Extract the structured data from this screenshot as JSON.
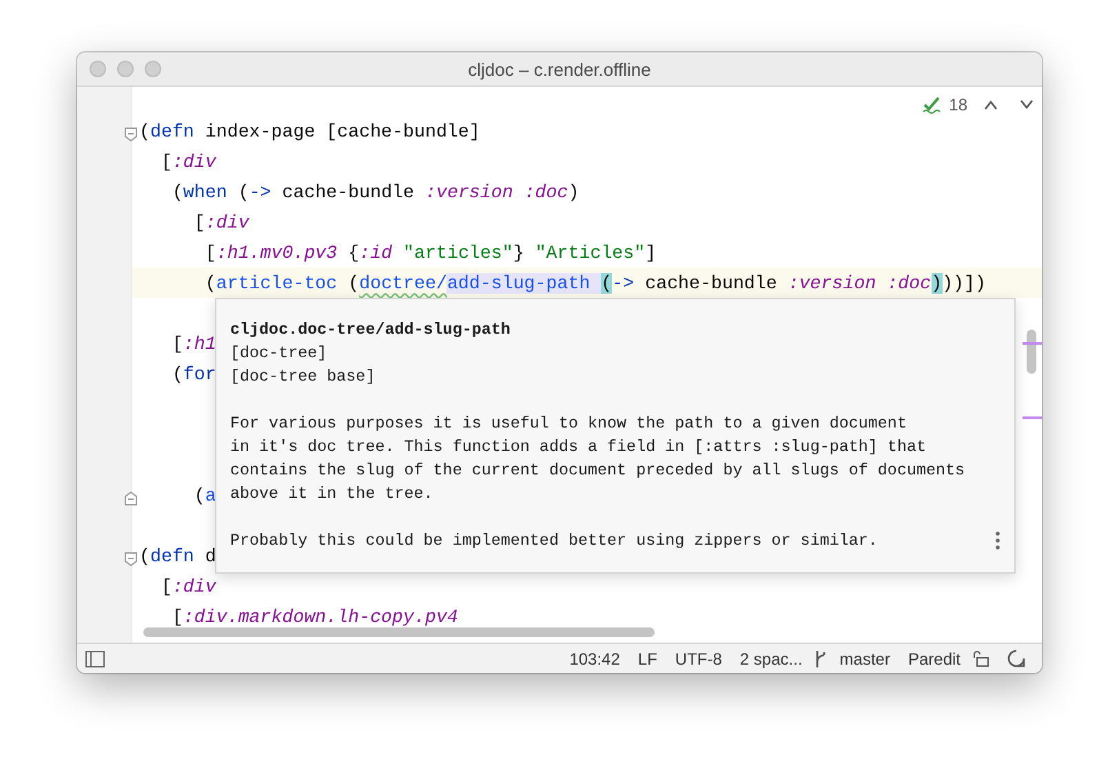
{
  "window": {
    "title": "cljdoc – c.render.offline"
  },
  "inspections": {
    "count": "18"
  },
  "code": {
    "lines": [
      {
        "kind": "opener",
        "current": false,
        "tokens": [
          {
            "text": "(",
            "kind": "plain"
          },
          {
            "text": "defn",
            "kind": "macro"
          },
          {
            "text": " index-page [cache-bundle]",
            "kind": "plain"
          }
        ]
      },
      {
        "kind": "code",
        "current": false,
        "tokens": [
          {
            "text": "  [",
            "kind": "plain"
          },
          {
            "text": ":div",
            "kind": "keyword"
          }
        ]
      },
      {
        "kind": "code",
        "current": false,
        "tokens": [
          {
            "text": "   (",
            "kind": "plain"
          },
          {
            "text": "when",
            "kind": "macro"
          },
          {
            "text": " (",
            "kind": "plain"
          },
          {
            "text": "->",
            "kind": "macro"
          },
          {
            "text": " cache-bundle ",
            "kind": "plain"
          },
          {
            "text": ":version :doc",
            "kind": "keyword"
          },
          {
            "text": ")",
            "kind": "plain"
          }
        ]
      },
      {
        "kind": "code",
        "current": false,
        "tokens": [
          {
            "text": "     [",
            "kind": "plain"
          },
          {
            "text": ":div",
            "kind": "keyword"
          }
        ]
      },
      {
        "kind": "code",
        "current": false,
        "tokens": [
          {
            "text": "      [",
            "kind": "plain"
          },
          {
            "text": ":h1.mv0.pv3",
            "kind": "keyword"
          },
          {
            "text": " {",
            "kind": "plain"
          },
          {
            "text": ":id",
            "kind": "keyword"
          },
          {
            "text": " \"articles\"",
            "kind": "string"
          },
          {
            "text": "} ",
            "kind": "plain"
          },
          {
            "text": "\"Articles\"",
            "kind": "string"
          },
          {
            "text": "]",
            "kind": "plain"
          }
        ]
      },
      {
        "kind": "code",
        "current": true,
        "tokens": [
          {
            "text": "      (",
            "kind": "plain"
          },
          {
            "text": "article-toc",
            "kind": "call"
          },
          {
            "text": " (",
            "kind": "plain"
          },
          {
            "text": "doctree/",
            "kind": "warn"
          },
          {
            "text": "add-slug-path ",
            "kind": "ref"
          },
          {
            "text": "(",
            "kind": "match"
          },
          {
            "text": "->",
            "kind": "macro"
          },
          {
            "text": " cache-bundle ",
            "kind": "plain"
          },
          {
            "text": ":version :doc",
            "kind": "keyword"
          },
          {
            "text": ")",
            "kind": "match"
          },
          {
            "text": "))])",
            "kind": "plain"
          }
        ]
      },
      {
        "kind": "blank"
      },
      {
        "kind": "code",
        "current": false,
        "tokens": [
          {
            "text": "   [",
            "kind": "plain"
          },
          {
            "text": ":h1",
            "kind": "keyword"
          }
        ]
      },
      {
        "kind": "code",
        "current": false,
        "tokens": [
          {
            "text": "   (",
            "kind": "plain"
          },
          {
            "text": "for",
            "kind": "macro"
          }
        ]
      },
      {
        "kind": "blank"
      },
      {
        "kind": "blank"
      },
      {
        "kind": "blank"
      },
      {
        "kind": "closer",
        "current": false,
        "tokens": [
          {
            "text": "     (",
            "kind": "plain"
          },
          {
            "text": "a",
            "kind": "call"
          }
        ]
      },
      {
        "kind": "blank"
      },
      {
        "kind": "opener",
        "current": false,
        "tokens": [
          {
            "text": "(",
            "kind": "plain"
          },
          {
            "text": "defn",
            "kind": "macro"
          },
          {
            "text": " d",
            "kind": "plain"
          }
        ]
      },
      {
        "kind": "code",
        "current": false,
        "tokens": [
          {
            "text": "  [",
            "kind": "plain"
          },
          {
            "text": ":div",
            "kind": "keyword"
          }
        ]
      },
      {
        "kind": "code",
        "current": false,
        "tokens": [
          {
            "text": "   [",
            "kind": "plain"
          },
          {
            "text": ":div.markdown.lh-copy.pv4",
            "kind": "keyword"
          }
        ]
      }
    ]
  },
  "popup": {
    "title": "cljdoc.doc-tree/add-slug-path",
    "signatures": [
      "[doc-tree]",
      "[doc-tree base]"
    ],
    "paragraphs": [
      "For various purposes it is useful to know the path to a given document\nin it's doc tree. This function adds a field in [:attrs :slug-path] that\ncontains the slug of the current document preceded by all slugs of documents\nabove it in the tree.",
      "Probably this could be implemented better using zippers or similar."
    ]
  },
  "status_bar": {
    "position": "103:42",
    "line_ending": "LF",
    "encoding": "UTF-8",
    "indent": "2 spac...",
    "branch": "master",
    "mode": "Paredit"
  }
}
